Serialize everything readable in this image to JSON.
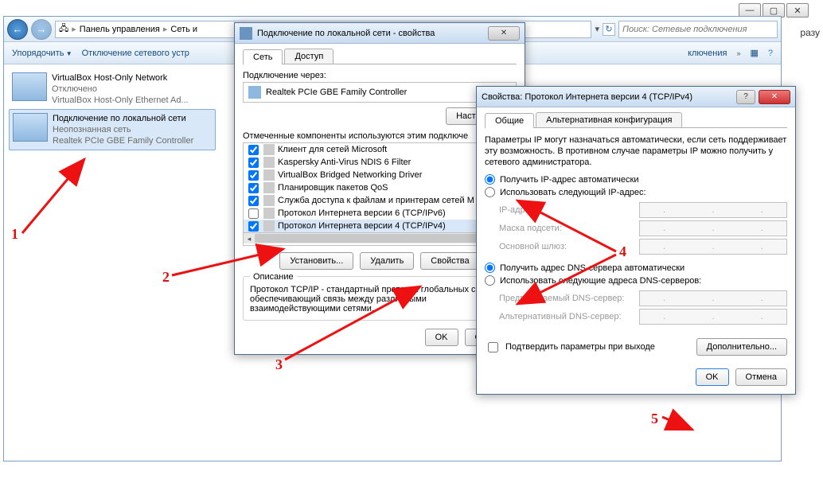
{
  "background_word": "разу",
  "explorer": {
    "breadcrumb": {
      "p1": "Панель управления",
      "p2": "Сеть и"
    },
    "search_placeholder": "Поиск: Сетевые подключения",
    "toolbar": {
      "organize": "Упорядочить",
      "disable": "Отключение сетевого устр",
      "suffix_item": "ключения",
      "chevrons": "»"
    },
    "conn1": {
      "name": "VirtualBox Host-Only Network",
      "status": "Отключено",
      "adapter": "VirtualBox Host-Only Ethernet Ad..."
    },
    "conn2": {
      "name": "Подключение по локальной сети",
      "status": "Неопознанная сеть",
      "adapter": "Realtek PCIe GBE Family Controller"
    }
  },
  "props_dialog": {
    "title": "Подключение по локальной сети - свойства",
    "tabs": {
      "net": "Сеть",
      "access": "Доступ"
    },
    "connect_via": "Подключение через:",
    "adapter": "Realtek PCIe GBE Family Controller",
    "configure_btn": "Настроить...",
    "components_label": "Отмеченные компоненты используются этим подключе",
    "components": [
      {
        "checked": true,
        "label": "Клиент для сетей Microsoft"
      },
      {
        "checked": true,
        "label": "Kaspersky Anti-Virus NDIS 6 Filter"
      },
      {
        "checked": true,
        "label": "VirtualBox Bridged Networking Driver"
      },
      {
        "checked": true,
        "label": "Планировщик пакетов QoS"
      },
      {
        "checked": true,
        "label": "Служба доступа к файлам и принтерам сетей M"
      },
      {
        "checked": false,
        "label": "Протокол Интернета версии 6 (TCP/IPv6)"
      },
      {
        "checked": true,
        "label": "Протокол Интернета версии 4 (TCP/IPv4)"
      }
    ],
    "btn_install": "Установить...",
    "btn_remove": "Удалить",
    "btn_props": "Свойства",
    "desc_title": "Описание",
    "desc_text": "Протокол TCP/IP - стандартный протокол глобальных сетей, обеспечивающий связь между различными взаимодействующими сетями.",
    "ok": "OK",
    "cancel": "Отмена"
  },
  "ipv4_dialog": {
    "title": "Свойства: Протокол Интернета версии 4 (TCP/IPv4)",
    "tabs": {
      "general": "Общие",
      "alt": "Альтернативная конфигурация"
    },
    "desc": "Параметры IP могут назначаться автоматически, если сеть поддерживает эту возможность. В противном случае параметры IP можно получить у сетевого администратора.",
    "radio_ip_auto": "Получить IP-адрес автоматически",
    "radio_ip_manual": "Использовать следующий IP-адрес:",
    "lbl_ip": "IP-адрес:",
    "lbl_mask": "Маска подсети:",
    "lbl_gw": "Основной шлюз:",
    "radio_dns_auto": "Получить адрес DNS-сервера автоматически",
    "radio_dns_manual": "Использовать следующие адреса DNS-серверов:",
    "lbl_dns1": "Предпочитаемый DNS-сервер:",
    "lbl_dns2": "Альтернативный DNS-сервер:",
    "check_confirm": "Подтвердить параметры при выходе",
    "btn_advanced": "Дополнительно...",
    "ok": "OK",
    "cancel": "Отмена"
  },
  "annotations": {
    "n1": "1",
    "n2": "2",
    "n3": "3",
    "n4": "4",
    "n5": "5"
  }
}
